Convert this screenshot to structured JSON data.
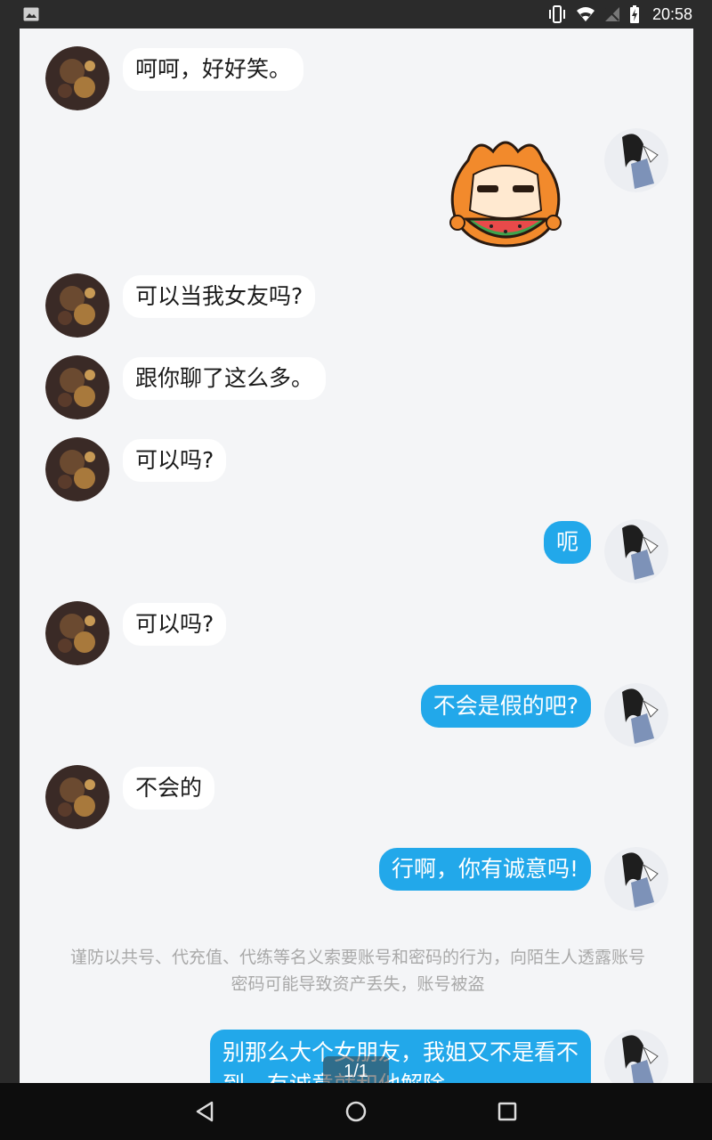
{
  "status_bar": {
    "time": "20:58",
    "icons": [
      "image-icon",
      "vibrate-icon",
      "wifi-icon",
      "no-signal-icon",
      "battery-charging-icon"
    ]
  },
  "messages": [
    {
      "side": "left",
      "text": "呵呵，好好笑。"
    },
    {
      "side": "right",
      "type": "sticker",
      "sticker": "orange-cat-eating-watermelon-sticker"
    },
    {
      "side": "left",
      "text": "可以当我女友吗?"
    },
    {
      "side": "left",
      "text": "跟你聊了这么多。"
    },
    {
      "side": "left",
      "text": "可以吗?"
    },
    {
      "side": "right",
      "text": "呃"
    },
    {
      "side": "left",
      "text": "可以吗?"
    },
    {
      "side": "right",
      "text": "不会是假的吧?"
    },
    {
      "side": "left",
      "text": "不会的"
    },
    {
      "side": "right",
      "text": "行啊，你有诚意吗!"
    },
    {
      "side": "right",
      "text": "别那么大个女朋友，我姐又不是看不到，有诚意就和他解除"
    }
  ],
  "notice": "谨防以共号、代充值、代练等名义索要账号和密码的行为，向陌生人透露账号密码可能导致资产丢失，账号被盗",
  "page_indicator": "1/1",
  "colors": {
    "right_bubble": "#22a8ea",
    "left_bubble": "#ffffff",
    "chat_background": "#f4f5f7",
    "notice_text": "#a9a9a9"
  },
  "nav_bar": [
    "back-icon",
    "home-icon",
    "recents-icon"
  ]
}
